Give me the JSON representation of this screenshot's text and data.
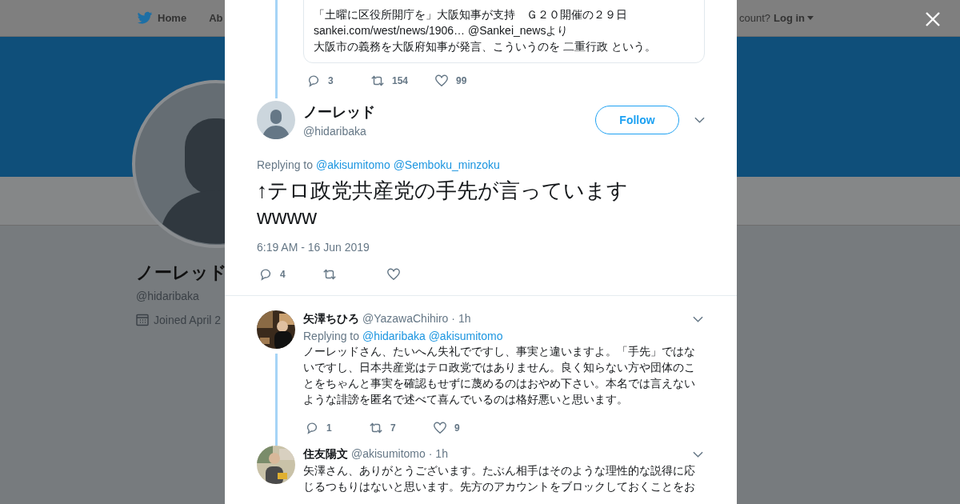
{
  "background": {
    "nav": [
      {
        "label": "Home"
      },
      {
        "label": "Ab"
      }
    ],
    "login_prompt": "count?",
    "login": "Log in",
    "profile": {
      "name": "ノーレッド",
      "handle": "@hidaribaka",
      "joined": "Joined April 2"
    }
  },
  "thread_above": {
    "quote_lines": [
      "「土曜に区役所開庁を」大阪知事が支持　Ｇ２０開催の２９日",
      "sankei.com/west/news/1906… @Sankei_newsより",
      "大阪市の義務を大阪府知事が発言、こういうのを 二重行政 という。"
    ],
    "actions": [
      {
        "kind": "reply",
        "count": "3"
      },
      {
        "kind": "retweet",
        "count": "154"
      },
      {
        "kind": "like",
        "count": "99"
      }
    ]
  },
  "tweet": {
    "name": "ノーレッド",
    "handle": "@hidaribaka",
    "follow": "Follow",
    "replying_label": "Replying to",
    "replying_to": [
      "@akisumitomo",
      "@Semboku_minzoku"
    ],
    "text_lines": [
      "↑テロ政党共産党の手先が言っています",
      "wwww"
    ],
    "time": "6:19 AM - 16 Jun 2019",
    "actions": [
      {
        "kind": "reply",
        "count": "4"
      },
      {
        "kind": "retweet"
      },
      {
        "kind": "like"
      }
    ]
  },
  "replies": [
    {
      "name": "矢澤ちひろ",
      "handle": "@YazawaChihiro",
      "age": "· 1h",
      "replying_label": "Replying to",
      "replying_to": [
        "@hidaribaka",
        "@akisumitomo"
      ],
      "text": "ノーレッドさん、たいへん失礼でですし、事実と違いますよ。「手先」ではないですし、日本共産党はテロ政党ではありません。良く知らない方や団体のことをちゃんと事実を確認もせずに蔑めるのはおやめ下さい。本名では言えないような誹謗を匿名で述べて喜んでいるのは格好悪いと思います。",
      "actions": [
        {
          "kind": "reply",
          "count": "1"
        },
        {
          "kind": "retweet",
          "count": "7"
        },
        {
          "kind": "like",
          "count": "9"
        }
      ]
    },
    {
      "name": "住友陽文",
      "handle": "@akisumitomo",
      "age": "· 1h",
      "text": "矢澤さん、ありがとうございます。たぶん相手はそのような理性的な説得に応じるつもりはないと思います。先方のアカウントをブロックしておくことをお"
    }
  ]
}
